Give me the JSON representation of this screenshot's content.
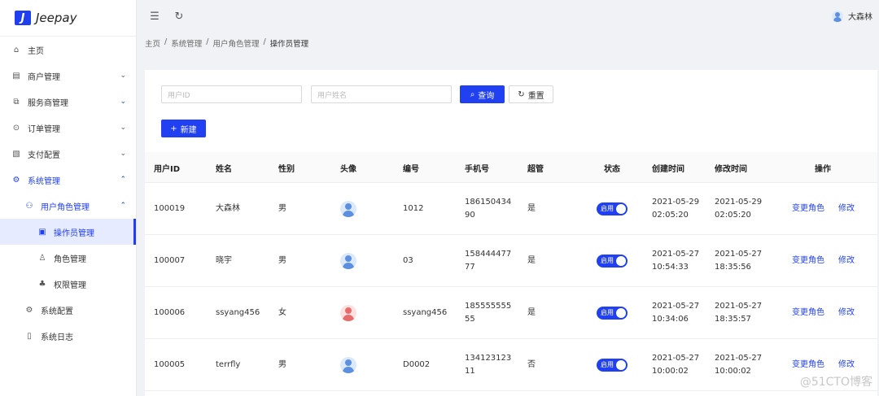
{
  "app": {
    "logo_mark": "J",
    "logo_text": "Jeepay"
  },
  "header": {
    "user_name": "大森林"
  },
  "breadcrumb": [
    "主页",
    "系统管理",
    "用户角色管理",
    "操作员管理"
  ],
  "sidebar": {
    "items": [
      {
        "label": "主页",
        "icon": "home-icon"
      },
      {
        "label": "商户管理",
        "icon": "store-icon"
      },
      {
        "label": "服务商管理",
        "icon": "copy-icon"
      },
      {
        "label": "订单管理",
        "icon": "order-icon"
      },
      {
        "label": "支付配置",
        "icon": "config-icon"
      },
      {
        "label": "系统管理",
        "icon": "gear-icon"
      },
      {
        "label": "用户角色管理",
        "icon": "users-icon"
      },
      {
        "label": "操作员管理",
        "icon": "idcard-icon"
      },
      {
        "label": "角色管理",
        "icon": "user-icon"
      },
      {
        "label": "权限管理",
        "icon": "tree-icon"
      },
      {
        "label": "系统配置",
        "icon": "gear-icon"
      },
      {
        "label": "系统日志",
        "icon": "file-icon"
      }
    ]
  },
  "search": {
    "user_id_placeholder": "用户ID",
    "user_name_placeholder": "用户姓名",
    "query_label": "查询",
    "reset_label": "重置",
    "create_label": "新建"
  },
  "table": {
    "columns": [
      "用户ID",
      "姓名",
      "性别",
      "头像",
      "编号",
      "手机号",
      "超管",
      "状态",
      "创建时间",
      "修改时间",
      "操作"
    ],
    "rows": [
      {
        "id": "100019",
        "name": "大森林",
        "gender": "男",
        "avatar": "male",
        "code": "1012",
        "phone": "18615043490",
        "admin": "是",
        "status": "启用",
        "created": "2021-05-29 02:05:20",
        "updated": "2021-05-29 02:05:20"
      },
      {
        "id": "100007",
        "name": "晓宇",
        "gender": "男",
        "avatar": "male",
        "code": "03",
        "phone": "15844447777",
        "admin": "是",
        "status": "启用",
        "created": "2021-05-27 10:54:33",
        "updated": "2021-05-27 18:35:56"
      },
      {
        "id": "100006",
        "name": "ssyang456",
        "gender": "女",
        "avatar": "female",
        "code": "ssyang456",
        "phone": "18555555555",
        "admin": "是",
        "status": "启用",
        "created": "2021-05-27 10:34:06",
        "updated": "2021-05-27 18:35:57"
      },
      {
        "id": "100005",
        "name": "terrfly",
        "gender": "男",
        "avatar": "male",
        "code": "D0002",
        "phone": "13412312311",
        "admin": "否",
        "status": "启用",
        "created": "2021-05-27 10:00:02",
        "updated": "2021-05-27 10:00:02"
      }
    ],
    "action_change_role": "变更角色",
    "action_edit": "修改"
  },
  "watermark": "@51CTO博客",
  "colors": {
    "primary": "#2140f2",
    "sidebar_active_bg": "#e6ebff"
  }
}
